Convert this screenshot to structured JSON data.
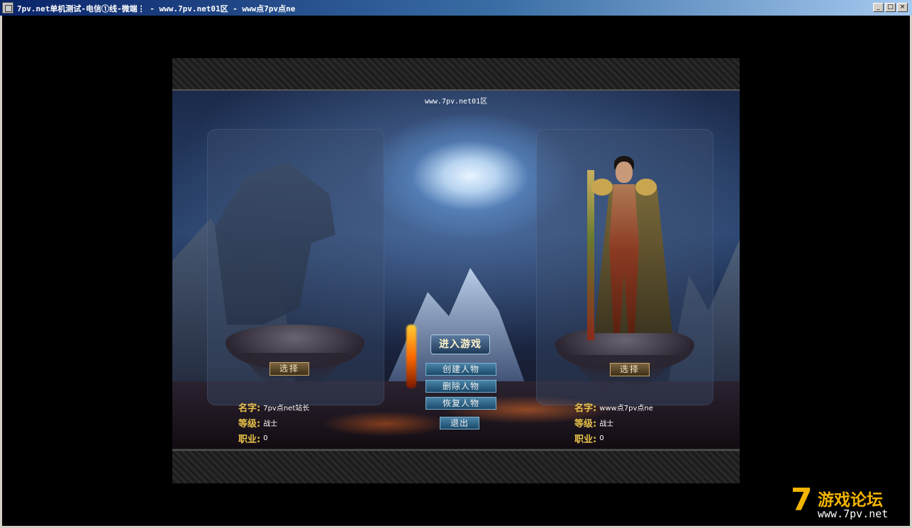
{
  "window": {
    "title": "7pv.net单机测试-电信①线-微端⋮ - www.7pv.net01区 - www点7pv点ne",
    "controls": {
      "minimize": "_",
      "maximize": "□",
      "close": "×"
    }
  },
  "game": {
    "server_label": "www.7pv.net01区",
    "left_slot": {
      "select_label": "选择",
      "name_label": "名字:",
      "name_value": "7pv点net站长",
      "level_label": "等级:",
      "level_value": "战士",
      "job_label": "职业:",
      "job_value": "0"
    },
    "right_slot": {
      "select_label": "选择",
      "name_label": "名字:",
      "name_value": "www点7pv点ne",
      "level_label": "等级:",
      "level_value": "战士",
      "job_label": "职业:",
      "job_value": "0"
    },
    "menu": {
      "enter": "进入游戏",
      "create": "创建人物",
      "delete": "删除人物",
      "restore": "恢复人物",
      "exit": "退出"
    }
  },
  "watermark": {
    "digit": "7",
    "title": "游戏论坛",
    "url": "www.7pv.net"
  }
}
